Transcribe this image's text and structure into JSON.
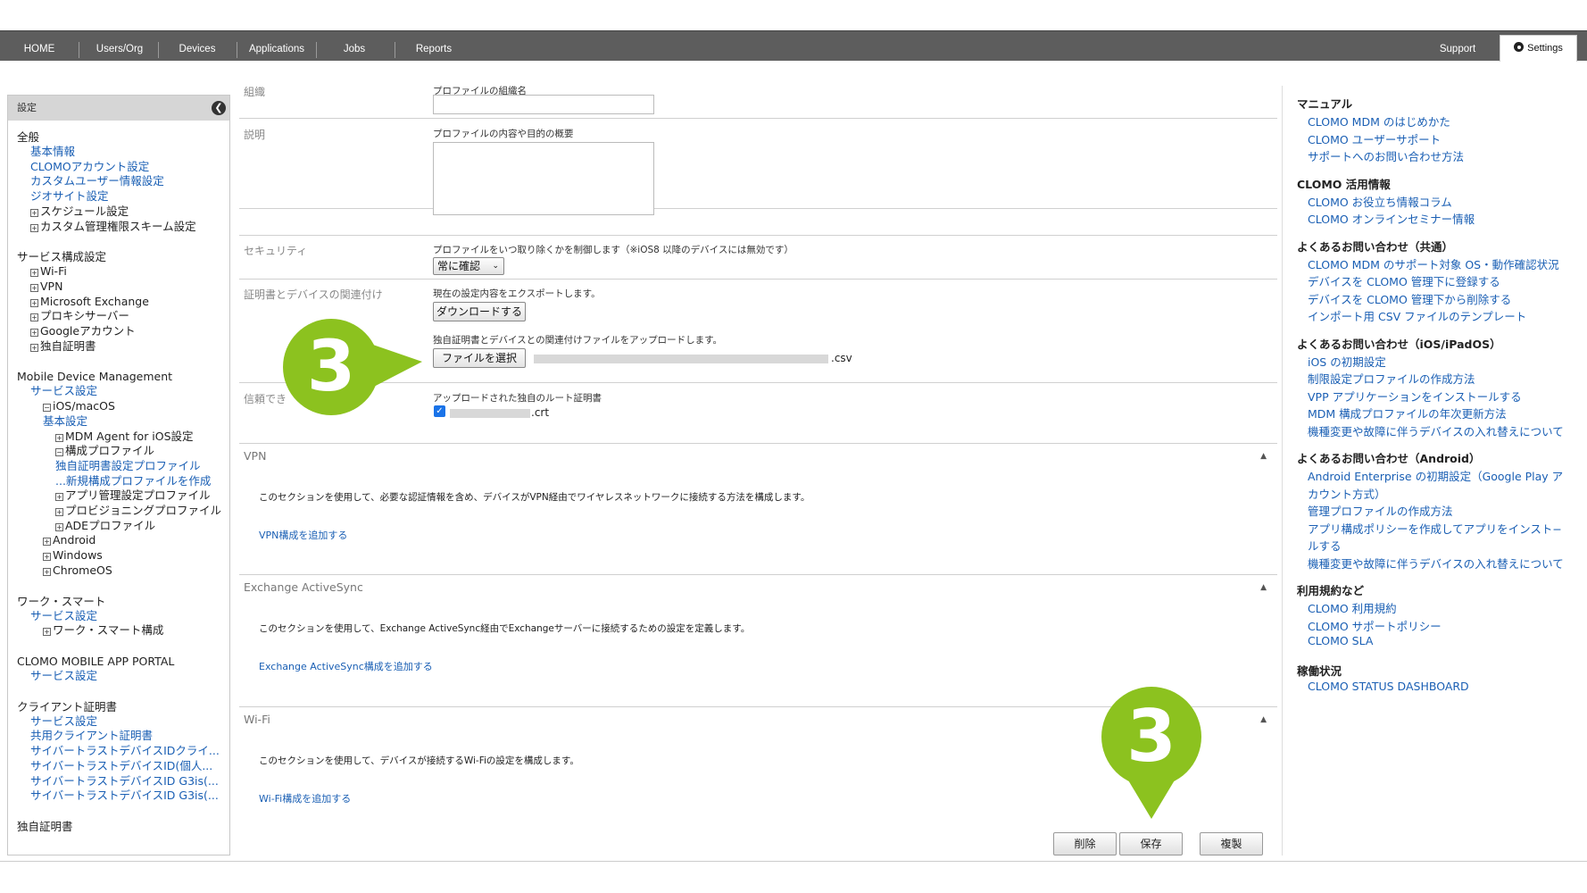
{
  "nav": {
    "items": [
      "HOME",
      "Users/Org",
      "Devices",
      "Applications",
      "Jobs",
      "Reports"
    ],
    "support": "Support",
    "settings": "Settings"
  },
  "sidebar": {
    "header": "設定",
    "groups": [
      {
        "title": "全般",
        "items": [
          {
            "type": "link",
            "label": "基本情報"
          },
          {
            "type": "link",
            "label": "CLOMOアカウント設定"
          },
          {
            "type": "link",
            "label": "カスタムユーザー情報設定"
          },
          {
            "type": "link",
            "label": "ジオサイト設定"
          },
          {
            "type": "node",
            "tog": "+",
            "label": "スケジュール設定"
          },
          {
            "type": "node",
            "tog": "+",
            "label": "カスタム管理権限スキーム設定"
          }
        ]
      },
      {
        "title": "サービス構成設定",
        "items": [
          {
            "type": "node",
            "tog": "+",
            "label": "Wi-Fi"
          },
          {
            "type": "node",
            "tog": "+",
            "label": "VPN"
          },
          {
            "type": "node",
            "tog": "+",
            "label": "Microsoft Exchange"
          },
          {
            "type": "node",
            "tog": "+",
            "label": "プロキシサーバー"
          },
          {
            "type": "node",
            "tog": "+",
            "label": "Googleアカウント"
          },
          {
            "type": "node",
            "tog": "+",
            "label": "独自証明書"
          }
        ]
      },
      {
        "title": "Mobile Device Management",
        "items": [
          {
            "type": "link",
            "label": "サービス設定"
          },
          {
            "type": "node",
            "tog": "-",
            "label": "iOS/macOS",
            "indent": 1
          },
          {
            "type": "link",
            "label": "基本設定",
            "indent": 1
          },
          {
            "type": "node",
            "tog": "+",
            "label": "MDM Agent for iOS設定",
            "indent": 2
          },
          {
            "type": "node",
            "tog": "-",
            "label": "構成プロファイル",
            "indent": 2
          },
          {
            "type": "link",
            "label": "独自証明書設定プロファイル",
            "indent": 2
          },
          {
            "type": "link",
            "label": "...新規構成プロファイルを作成",
            "indent": 2
          },
          {
            "type": "node",
            "tog": "+",
            "label": "アプリ管理設定プロファイル",
            "indent": 2
          },
          {
            "type": "node",
            "tog": "+",
            "label": "プロビジョニングプロファイル",
            "indent": 2
          },
          {
            "type": "node",
            "tog": "+",
            "label": "ADEプロファイル",
            "indent": 2
          },
          {
            "type": "node",
            "tog": "+",
            "label": "Android",
            "indent": 1
          },
          {
            "type": "node",
            "tog": "+",
            "label": "Windows",
            "indent": 1
          },
          {
            "type": "node",
            "tog": "+",
            "label": "ChromeOS",
            "indent": 1
          }
        ]
      },
      {
        "title": "ワーク・スマート",
        "items": [
          {
            "type": "link",
            "label": "サービス設定"
          },
          {
            "type": "node",
            "tog": "+",
            "label": "ワーク・スマート構成",
            "indent": 1
          }
        ]
      },
      {
        "title": "CLOMO MOBILE APP PORTAL",
        "items": [
          {
            "type": "link",
            "label": "サービス設定"
          }
        ]
      },
      {
        "title": "クライアント証明書",
        "items": [
          {
            "type": "link",
            "label": "サービス設定"
          },
          {
            "type": "link",
            "label": "共用クライアント証明書"
          },
          {
            "type": "link",
            "label": "サイバートラストデバイスIDクライ..."
          },
          {
            "type": "link",
            "label": "サイバートラストデバイスID(個人..."
          },
          {
            "type": "link",
            "label": "サイバートラストデバイスID G3is(..."
          },
          {
            "type": "link",
            "label": "サイバートラストデバイスID G3is(..."
          }
        ]
      },
      {
        "title": "独自証明書",
        "items": []
      }
    ]
  },
  "form": {
    "org_label": "組織",
    "org_caption": "プロファイルの組織名",
    "desc_label": "説明",
    "desc_caption": "プロファイルの内容や目的の概要",
    "security_label": "セキュリティ",
    "security_caption": "プロファイルをいつ取り除くかを制御します（※iOS8 以降のデバイスには無効です）",
    "security_select": "常に確認",
    "cert_label": "証明書とデバイスの関連付け",
    "export_caption": "現在の設定内容をエクスポートします。",
    "download_button": "ダウンロードする",
    "upload_caption": "独自証明書とデバイスとの関連付けファイルをアップロードします。",
    "choose_file_button": "ファイルを選択",
    "file_ext": ".csv",
    "trust_label": "信頼でき",
    "root_caption": "アップロードされた独自のルート証明書",
    "root_file_ext": ".crt"
  },
  "sections": [
    {
      "title": "VPN",
      "desc": "このセクションを使用して、必要な認証情報を含め、デバイスがVPN経由でワイヤレスネットワークに接続する方法を構成します。",
      "link": "VPN構成を追加する"
    },
    {
      "title": "Exchange ActiveSync",
      "desc": "このセクションを使用して、Exchange ActiveSync経由でExchangeサーバーに接続するための設定を定義します。",
      "link": "Exchange ActiveSync構成を追加する"
    },
    {
      "title": "Wi-Fi",
      "desc": "このセクションを使用して、デバイスが接続するWi-Fiの設定を構成します。",
      "link": "Wi-Fi構成を追加する"
    }
  ],
  "actions": {
    "delete": "削除",
    "save": "保存",
    "duplicate": "複製"
  },
  "callouts": {
    "step": "3",
    "color": "#8cc21f"
  },
  "right": {
    "groups": [
      {
        "title": "マニュアル",
        "links": [
          "CLOMO MDM のはじめかた",
          "CLOMO ユーザーサポート",
          "サポートへのお問い合わせ方法"
        ]
      },
      {
        "title": "CLOMO 活用情報",
        "links": [
          "CLOMO お役立ち情報コラム",
          "CLOMO オンラインセミナー情報"
        ]
      },
      {
        "title": "よくあるお問い合わせ（共通）",
        "links": [
          "CLOMO MDM のサポート対象 OS・動作確認状況",
          "デバイスを CLOMO 管理下に登録する",
          "デバイスを CLOMO 管理下から削除する",
          "インポート用 CSV ファイルのテンプレート"
        ]
      },
      {
        "title": "よくあるお問い合わせ（iOS/iPadOS）",
        "links": [
          "iOS の初期設定",
          "制限設定プロファイルの作成方法",
          "VPP アプリケーションをインストールする",
          "MDM 構成プロファイルの年次更新方法",
          "機種変更や故障に伴うデバイスの入れ替えについて"
        ]
      },
      {
        "title": "よくあるお問い合わせ（Android）",
        "links": [
          "Android Enterprise の初期設定（Google Play ア",
          "カウント方式）",
          "管理プロファイルの作成方法",
          "アプリ構成ポリシーを作成してアプリをインスト−",
          "ルする",
          "機種変更や故障に伴うデバイスの入れ替えについて"
        ]
      },
      {
        "title": "利用規約など",
        "links": [
          "CLOMO 利用規約",
          "CLOMO サポートポリシー",
          "CLOMO SLA"
        ]
      },
      {
        "title": "稼働状況",
        "links": [
          "CLOMO STATUS DASHBOARD"
        ]
      }
    ]
  }
}
